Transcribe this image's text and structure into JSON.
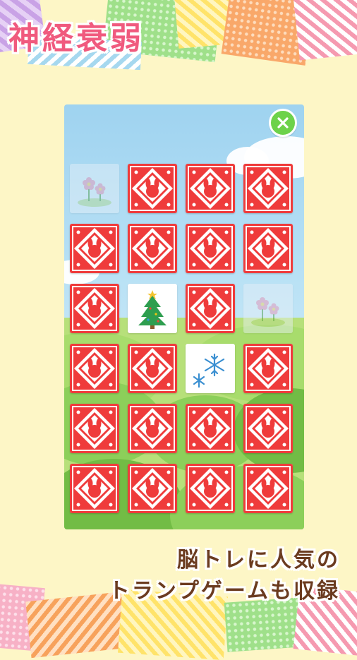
{
  "header": {
    "title": "神経衰弱"
  },
  "game": {
    "close_icon": "close-x-icon",
    "card_back_icon": "rabbit-icon",
    "rows": [
      [
        "flower-matched",
        "back",
        "back",
        "back"
      ],
      [
        "back",
        "back",
        "back",
        "back"
      ],
      [
        "back",
        "christmas-tree",
        "back",
        "flower-matched"
      ],
      [
        "back",
        "back",
        "snowflake",
        "back"
      ],
      [
        "back",
        "back",
        "back",
        "back"
      ],
      [
        "back",
        "back",
        "back",
        "back"
      ]
    ]
  },
  "caption": {
    "line1": "脳トレに人気の",
    "line2": "トランプゲームも収録"
  },
  "colors": {
    "card_back": "#ef3b3b",
    "title": "#f05a7e",
    "caption": "#6b3b1f",
    "close_button": "#6dd24a"
  }
}
